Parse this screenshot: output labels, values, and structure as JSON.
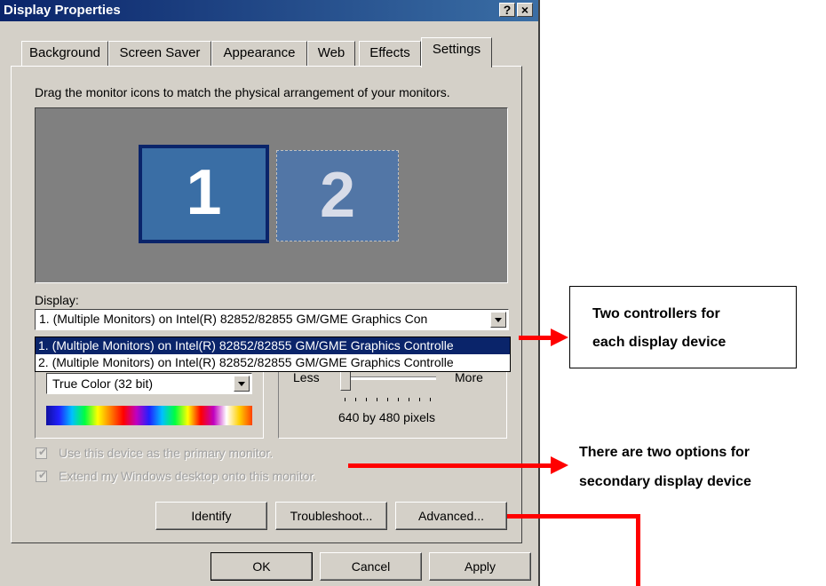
{
  "window": {
    "title": "Display Properties",
    "help_btn": "?",
    "close_btn": "×"
  },
  "tabs": [
    {
      "label": "Background"
    },
    {
      "label": "Screen Saver"
    },
    {
      "label": "Appearance"
    },
    {
      "label": "Web"
    },
    {
      "label": "Effects"
    },
    {
      "label": "Settings"
    }
  ],
  "settings": {
    "instruction": "Drag the monitor icons to match the physical arrangement of your monitors.",
    "monitors": [
      "1",
      "2"
    ],
    "display_label": "Display:",
    "display_value": "1. (Multiple Monitors) on Intel(R) 82852/82855 GM/GME Graphics Con",
    "display_options": [
      "1. (Multiple Monitors) on Intel(R) 82852/82855 GM/GME Graphics Controlle",
      "2. (Multiple Monitors) on Intel(R) 82852/82855 GM/GME Graphics Controlle"
    ],
    "color_quality": "True Color (32 bit)",
    "resolution_less": "Less",
    "resolution_more": "More",
    "resolution": "640 by 480 pixels",
    "primary_checkbox": "Use this device as the primary monitor.",
    "extend_checkbox": "Extend my Windows desktop onto this monitor.",
    "identify_btn": "Identify",
    "troubleshoot_btn": "Troubleshoot...",
    "advanced_btn": "Advanced..."
  },
  "footer": {
    "ok": "OK",
    "cancel": "Cancel",
    "apply": "Apply"
  },
  "annotations": {
    "controllers_line1": "Two controllers for",
    "controllers_line2": "each display device",
    "options_line1": "There are two options for",
    "options_line2": "secondary display device"
  },
  "colors": {
    "annotation_arrow": "#ff0000",
    "titlebar": "#0a246a",
    "selection": "#0a246a"
  }
}
